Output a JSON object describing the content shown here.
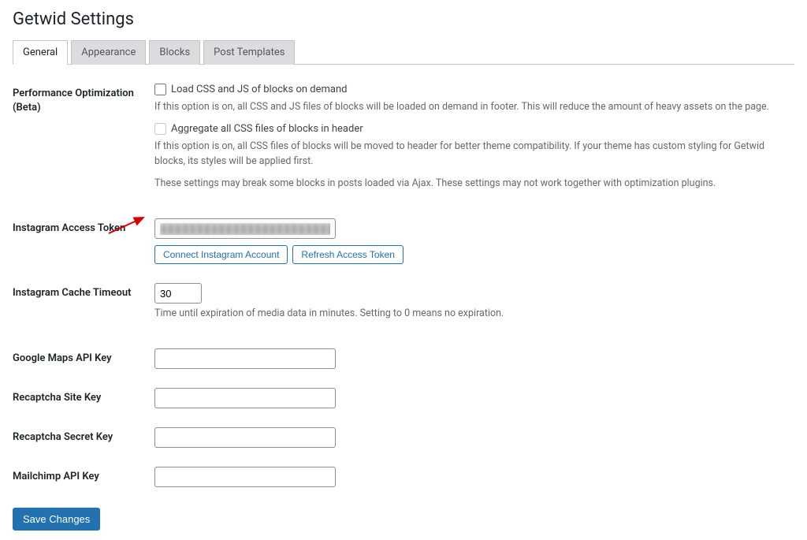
{
  "page": {
    "title": "Getwid Settings"
  },
  "tabs": {
    "general": "General",
    "appearance": "Appearance",
    "blocks": "Blocks",
    "post_templates": "Post Templates"
  },
  "performance": {
    "label": "Performance Optimization (Beta)",
    "load_on_demand": "Load CSS and JS of blocks on demand",
    "load_on_demand_desc": "If this option is on, all CSS and JS files of blocks will be loaded on demand in footer. This will reduce the amount of heavy assets on the page.",
    "aggregate": "Aggregate all CSS files of blocks in header",
    "aggregate_desc": "If this option is on, all CSS files of blocks will be moved to header for better theme compatibility. If your theme has custom styling for Getwid blocks, its styles will be applied first.",
    "note": "These settings may break some blocks in posts loaded via Ajax. These settings may not work together with optimization plugins."
  },
  "instagram_token": {
    "label": "Instagram Access Token",
    "value": "████████████████████████",
    "connect": "Connect Instagram Account",
    "refresh": "Refresh Access Token"
  },
  "instagram_timeout": {
    "label": "Instagram Cache Timeout",
    "value": "30",
    "desc": "Time until expiration of media data in minutes. Setting to 0 means no expiration."
  },
  "google_maps": {
    "label": "Google Maps API Key",
    "value": ""
  },
  "recaptcha_site": {
    "label": "Recaptcha Site Key",
    "value": ""
  },
  "recaptcha_secret": {
    "label": "Recaptcha Secret Key",
    "value": ""
  },
  "mailchimp": {
    "label": "Mailchimp API Key",
    "value": ""
  },
  "actions": {
    "save": "Save Changes"
  }
}
